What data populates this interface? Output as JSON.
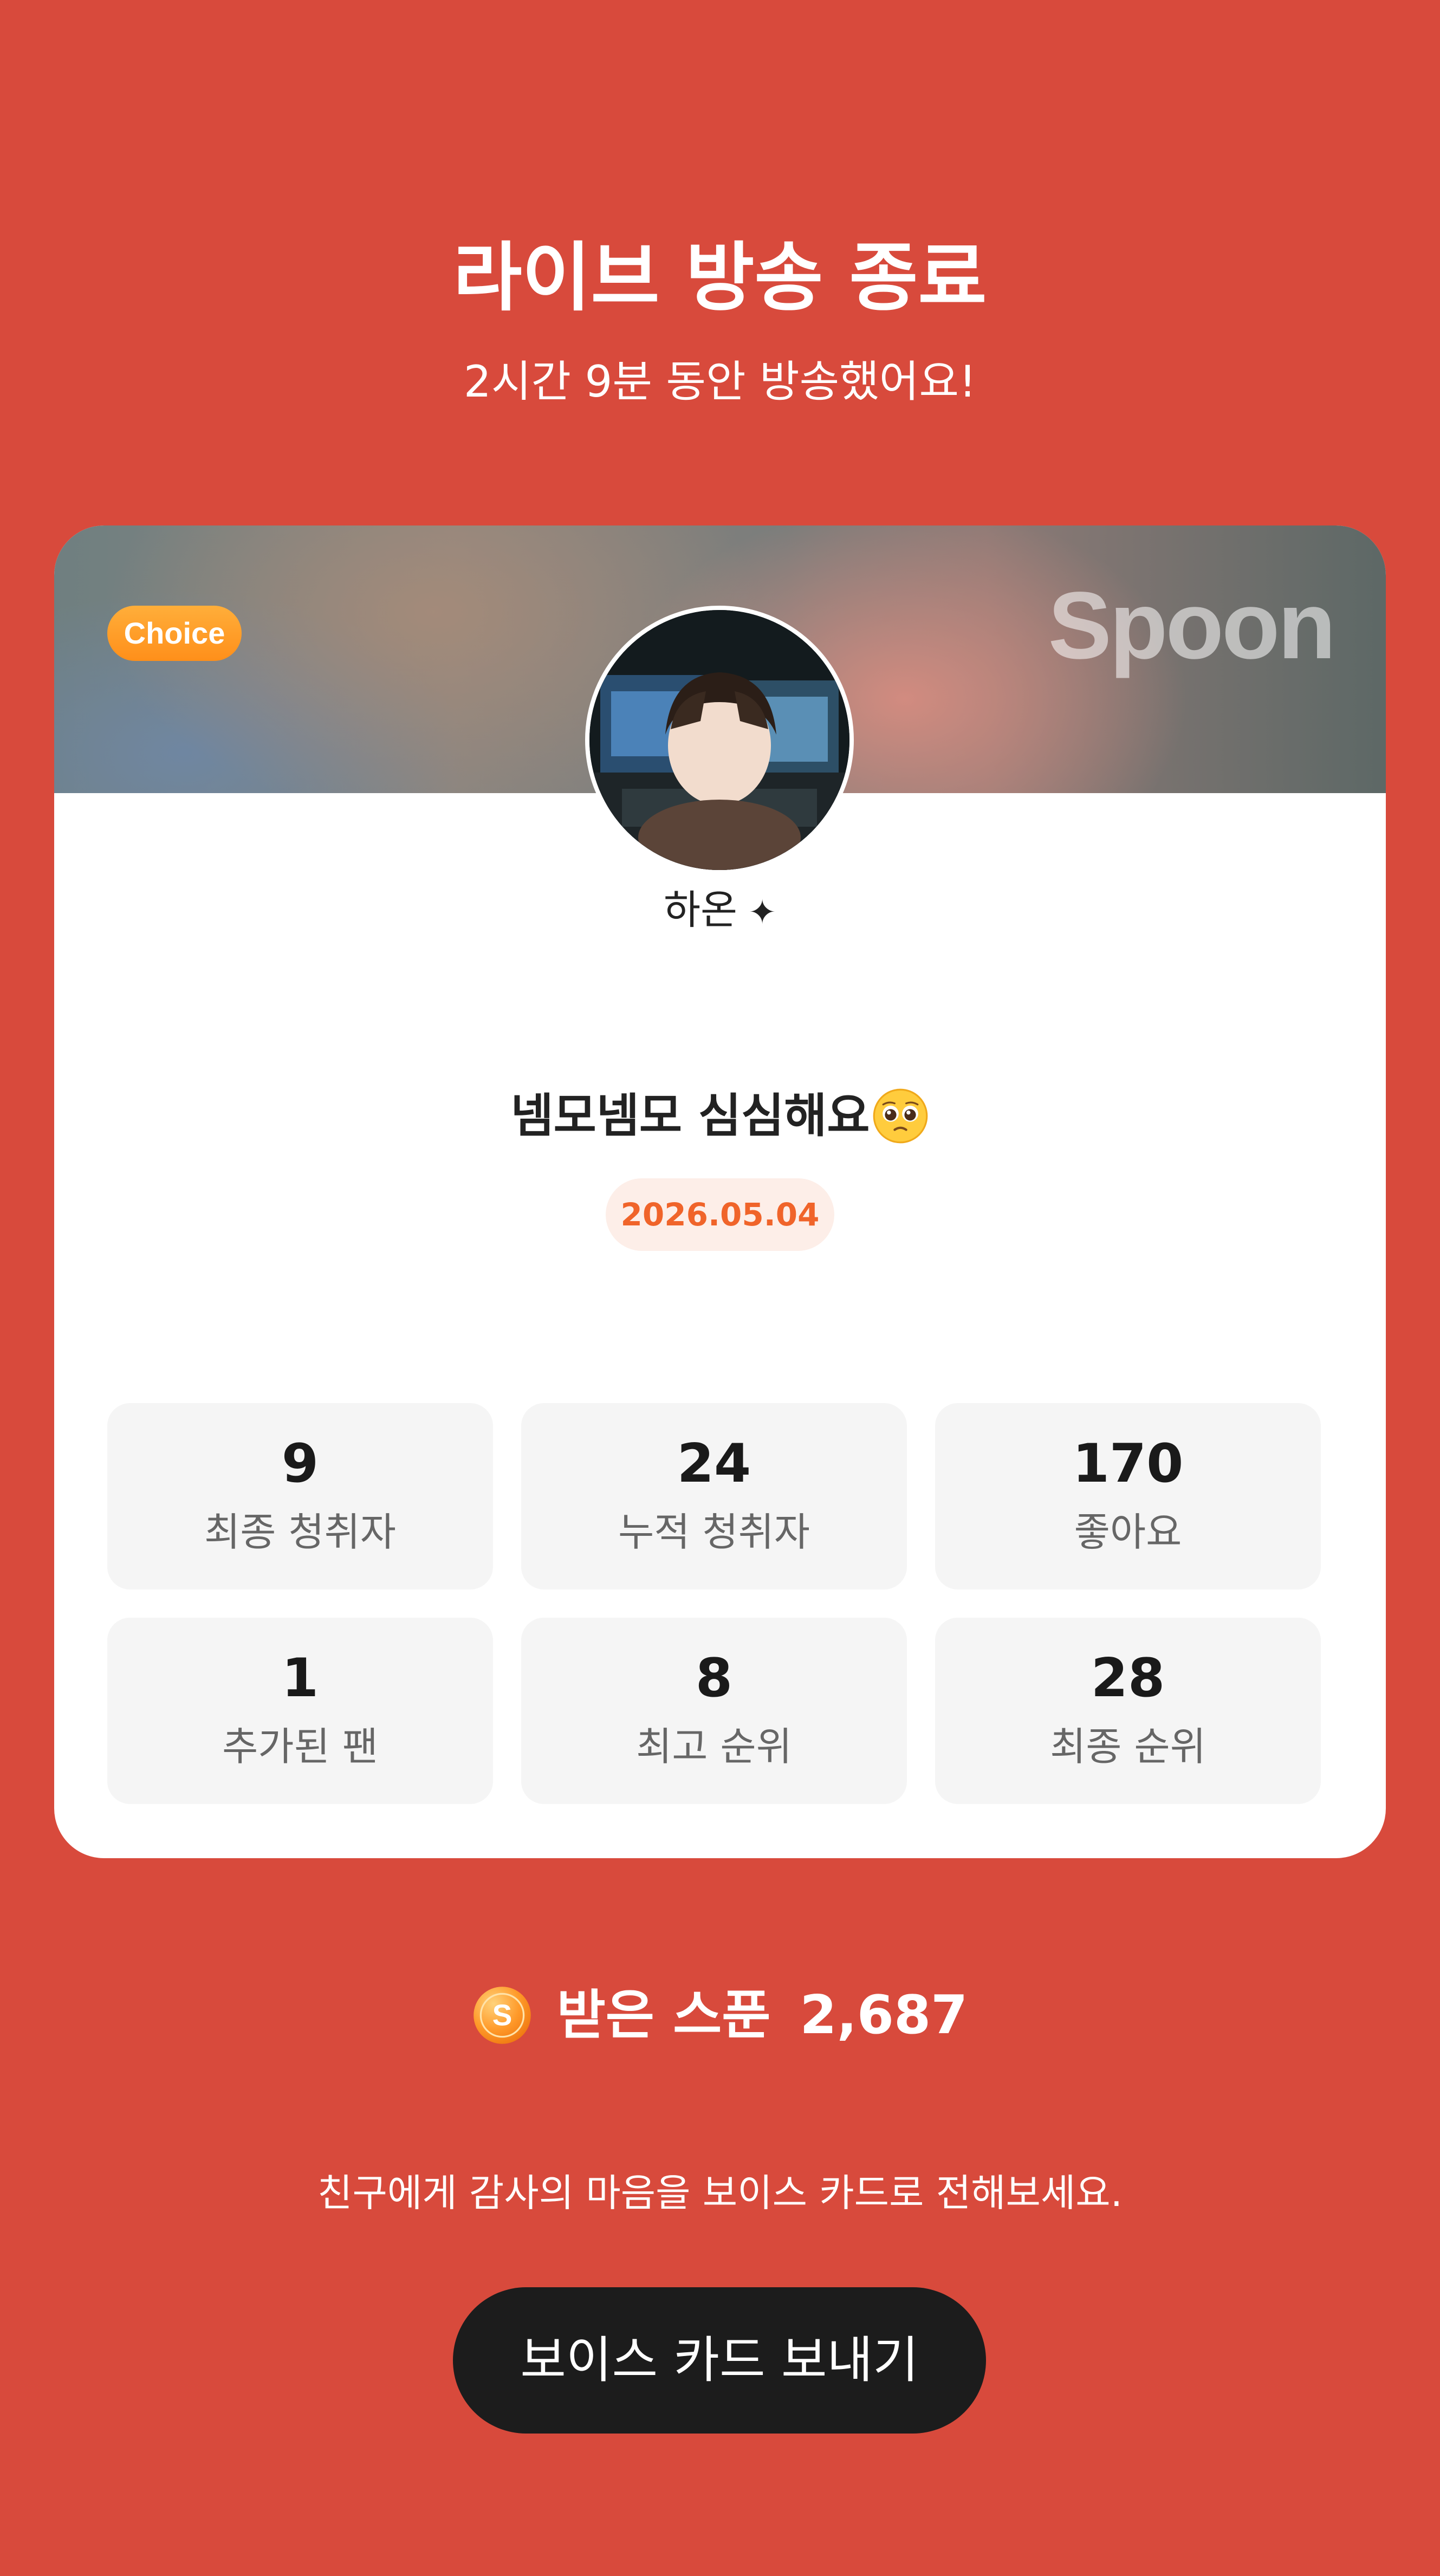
{
  "header": {
    "title": "라이브 방송 종료",
    "subtitle": "2시간 9분 동안 방송했어요!"
  },
  "card": {
    "badge": "Choice",
    "brand": "Spoon",
    "avatar_icon": "host-avatar",
    "host_name": "하온",
    "host_name_icon": "sparkle-icon",
    "live_title": "넴모넴모 심심해요",
    "live_title_emoji": "pleading-face-emoji",
    "date": "2026.05.04",
    "stats": [
      {
        "value": "9",
        "label": "최종 청취자"
      },
      {
        "value": "24",
        "label": "누적 청취자"
      },
      {
        "value": "170",
        "label": "좋아요"
      },
      {
        "value": "1",
        "label": "추가된 팬"
      },
      {
        "value": "8",
        "label": "최고 순위"
      },
      {
        "value": "28",
        "label": "최종 순위"
      }
    ]
  },
  "spoons": {
    "icon": "spoon-coin-icon",
    "label": "받은 스푼",
    "value": "2,687"
  },
  "footer": {
    "message": "친구에게 감사의 마음을 보이스 카드로 전해보세요.",
    "button_label": "보이스 카드 보내기"
  },
  "colors": {
    "background": "#d84a3c",
    "card": "#ffffff",
    "date_text": "#f0642a",
    "date_bg": "#fdeee8",
    "choice_badge": "#ff9a22",
    "button": "#1c1c1c"
  }
}
